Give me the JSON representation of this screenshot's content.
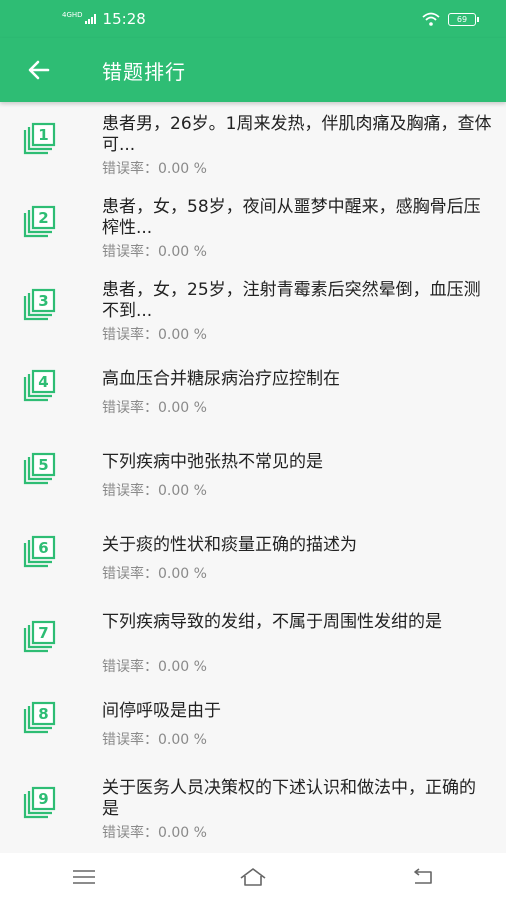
{
  "status_bar": {
    "network": "4GHD",
    "time": "15:28",
    "battery": "69"
  },
  "header": {
    "title": "错题排行"
  },
  "rate_label": "错误率",
  "questions": [
    {
      "num": "1",
      "text": "患者男，26岁。1周来发热，伴肌肉痛及胸痛，查体可...",
      "rate": "：0.00 %"
    },
    {
      "num": "2",
      "text": "患者，女，58岁，夜间从噩梦中醒来，感胸骨后压榨性...",
      "rate": "：0.00 %"
    },
    {
      "num": "3",
      "text": "患者，女，25岁，注射青霉素后突然晕倒，血压测不到...",
      "rate": "：0.00 %"
    },
    {
      "num": "4",
      "text": "高血压合并糖尿病治疗应控制在",
      "rate": "：0.00 %"
    },
    {
      "num": "5",
      "text": "下列疾病中弛张热不常见的是",
      "rate": "：0.00 %"
    },
    {
      "num": "6",
      "text": "关于痰的性状和痰量正确的描述为",
      "rate": "：0.00 %"
    },
    {
      "num": "7",
      "text": "下列疾病导致的发绀，不属于周围性发绀的是",
      "rate": "：0.00 %"
    },
    {
      "num": "8",
      "text": "间停呼吸是由于",
      "rate": "：0.00 %"
    },
    {
      "num": "9",
      "text": "关于医务人员决策权的下述认识和做法中，正确的是",
      "rate": "：0.00 %"
    }
  ],
  "icons": {
    "back": "arrow-left-icon",
    "badge": "stacked-number-badge-icon",
    "nav_menu": "menu-icon",
    "nav_home": "home-icon",
    "nav_back": "return-icon"
  },
  "colors": {
    "primary": "#2ebd74",
    "background": "#f7f7f7",
    "text": "#222222",
    "secondary_text": "#8a8a8a"
  }
}
